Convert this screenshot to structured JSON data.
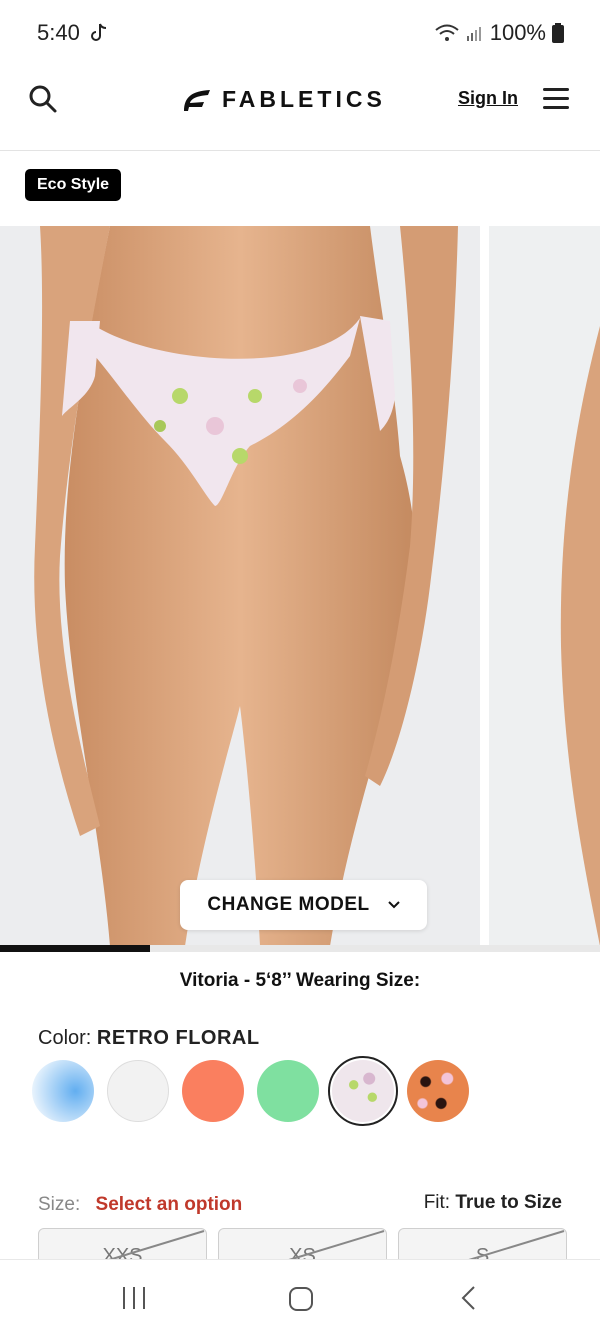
{
  "status_bar": {
    "time": "5:40",
    "battery": "100%"
  },
  "header": {
    "brand": "FABLETICS",
    "sign_in": "Sign In"
  },
  "badge": "Eco Style",
  "gallery": {
    "change_model_label": "CHANGE MODEL",
    "progress": 0.25
  },
  "model_info": "Vitoria - 5‘8’’ Wearing Size:",
  "color": {
    "label": "Color:",
    "selected": "RETRO FLORAL",
    "swatches": [
      {
        "name": "blue",
        "color": "#6fb8f0"
      },
      {
        "name": "white",
        "color": "#f2f2f2"
      },
      {
        "name": "coral",
        "color": "#fa7f5f"
      },
      {
        "name": "mint",
        "color": "#7fe0a0"
      },
      {
        "name": "retro-floral",
        "color": "#eadfe6"
      },
      {
        "name": "leopard",
        "color": "#e8844c"
      }
    ]
  },
  "size": {
    "label": "Size:",
    "prompt": "Select an option",
    "fit_label": "Fit:",
    "fit_value": "True to Size",
    "options": [
      "XXS",
      "XS",
      "S"
    ]
  }
}
